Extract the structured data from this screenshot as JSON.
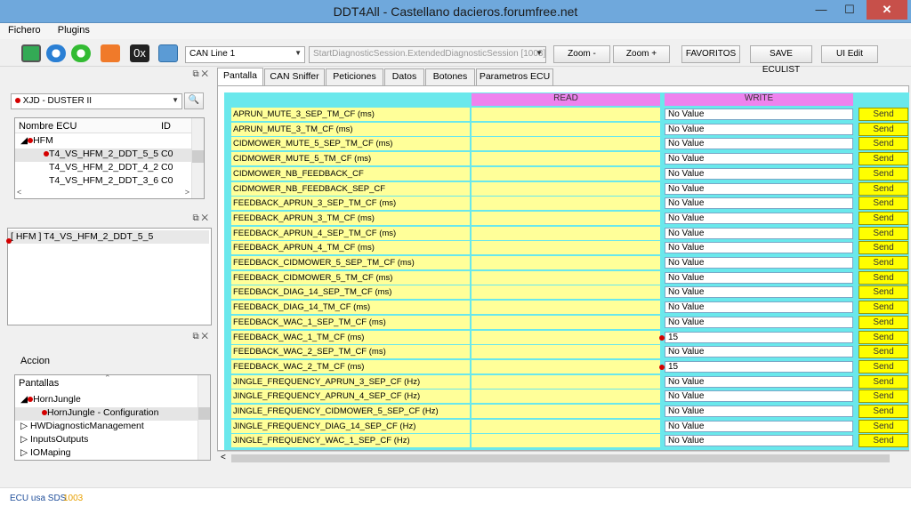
{
  "window": {
    "title": "DDT4All - Castellano dacieros.forumfree.net",
    "minimize": "—",
    "maximize": "☐",
    "close": "✕"
  },
  "menu": [
    "Fichero",
    "Plugins"
  ],
  "toolbar": {
    "icons": [
      "scope-icon",
      "refresh-icon",
      "connect-icon",
      "heart-monitor-icon",
      "hex-icon",
      "network-icon"
    ],
    "hex_label": "0x",
    "can_line": "CAN Line 1",
    "session": "StartDiagnosticSession.ExtendedDiagnosticSession [1003]",
    "zoom_out": "Zoom -",
    "zoom_in": "Zoom +",
    "favoritos": "FAVORITOS",
    "save_eculist": "SAVE ECULIST",
    "ui_edit": "UI Edit"
  },
  "vehicle": {
    "selected": "XJD - DUSTER II"
  },
  "ecu_list": {
    "col_name": "Nombre ECU",
    "col_id": "ID",
    "group": "HFM",
    "items": [
      {
        "name": "T4_VS_HFM_2_DDT_5_5",
        "id": "C0"
      },
      {
        "name": "T4_VS_HFM_2_DDT_4_2",
        "id": "C0"
      },
      {
        "name": "T4_VS_HFM_2_DDT_3_6",
        "id": "C0"
      }
    ]
  },
  "selected_ecu": "[ HFM ] T4_VS_HFM_2_DDT_5_5",
  "accion_label": "Accion",
  "pantallas": {
    "header": "Pantallas",
    "items": [
      "HornJungle",
      "HornJungle - Configuration",
      "HWDiagnosticManagement",
      "InputsOutputs",
      "IOMaping"
    ]
  },
  "tabs": [
    "Pantalla",
    "CAN Sniffer",
    "Peticiones",
    "Datos",
    "Botones",
    "Parametros ECU"
  ],
  "grid": {
    "read_header": "READ",
    "write_header": "WRITE",
    "send_label": "Send",
    "rows": [
      {
        "label": "APRUN_MUTE_3_SEP_TM_CF (ms)",
        "write": "No Value"
      },
      {
        "label": "APRUN_MUTE_3_TM_CF (ms)",
        "write": "No Value"
      },
      {
        "label": "CIDMOWER_MUTE_5_SEP_TM_CF (ms)",
        "write": "No Value"
      },
      {
        "label": "CIDMOWER_MUTE_5_TM_CF (ms)",
        "write": "No Value"
      },
      {
        "label": "CIDMOWER_NB_FEEDBACK_CF",
        "write": "No Value"
      },
      {
        "label": "CIDMOWER_NB_FEEDBACK_SEP_CF",
        "write": "No Value"
      },
      {
        "label": "FEEDBACK_APRUN_3_SEP_TM_CF (ms)",
        "write": "No Value"
      },
      {
        "label": "FEEDBACK_APRUN_3_TM_CF (ms)",
        "write": "No Value"
      },
      {
        "label": "FEEDBACK_APRUN_4_SEP_TM_CF (ms)",
        "write": "No Value"
      },
      {
        "label": "FEEDBACK_APRUN_4_TM_CF (ms)",
        "write": "No Value"
      },
      {
        "label": "FEEDBACK_CIDMOWER_5_SEP_TM_CF (ms)",
        "write": "No Value"
      },
      {
        "label": "FEEDBACK_CIDMOWER_5_TM_CF (ms)",
        "write": "No Value"
      },
      {
        "label": "FEEDBACK_DIAG_14_SEP_TM_CF (ms)",
        "write": "No Value"
      },
      {
        "label": "FEEDBACK_DIAG_14_TM_CF (ms)",
        "write": "No Value"
      },
      {
        "label": "FEEDBACK_WAC_1_SEP_TM_CF (ms)",
        "write": "No Value"
      },
      {
        "label": "FEEDBACK_WAC_1_TM_CF (ms)",
        "write": "15",
        "marked": true
      },
      {
        "label": "FEEDBACK_WAC_2_SEP_TM_CF (ms)",
        "write": "No Value"
      },
      {
        "label": "FEEDBACK_WAC_2_TM_CF (ms)",
        "write": "15",
        "marked": true
      },
      {
        "label": "JINGLE_FREQUENCY_APRUN_3_SEP_CF (Hz)",
        "write": "No Value"
      },
      {
        "label": "JINGLE_FREQUENCY_APRUN_4_SEP_CF (Hz)",
        "write": "No Value"
      },
      {
        "label": "JINGLE_FREQUENCY_CIDMOWER_5_SEP_CF (Hz)",
        "write": "No Value"
      },
      {
        "label": "JINGLE_FREQUENCY_DIAG_14_SEP_CF (Hz)",
        "write": "No Value"
      },
      {
        "label": "JINGLE_FREQUENCY_WAC_1_SEP_CF (Hz)",
        "write": "No Value"
      }
    ]
  },
  "status": {
    "text": "ECU usa SDS",
    "code": "1003",
    "code_color": "#e8a000"
  }
}
